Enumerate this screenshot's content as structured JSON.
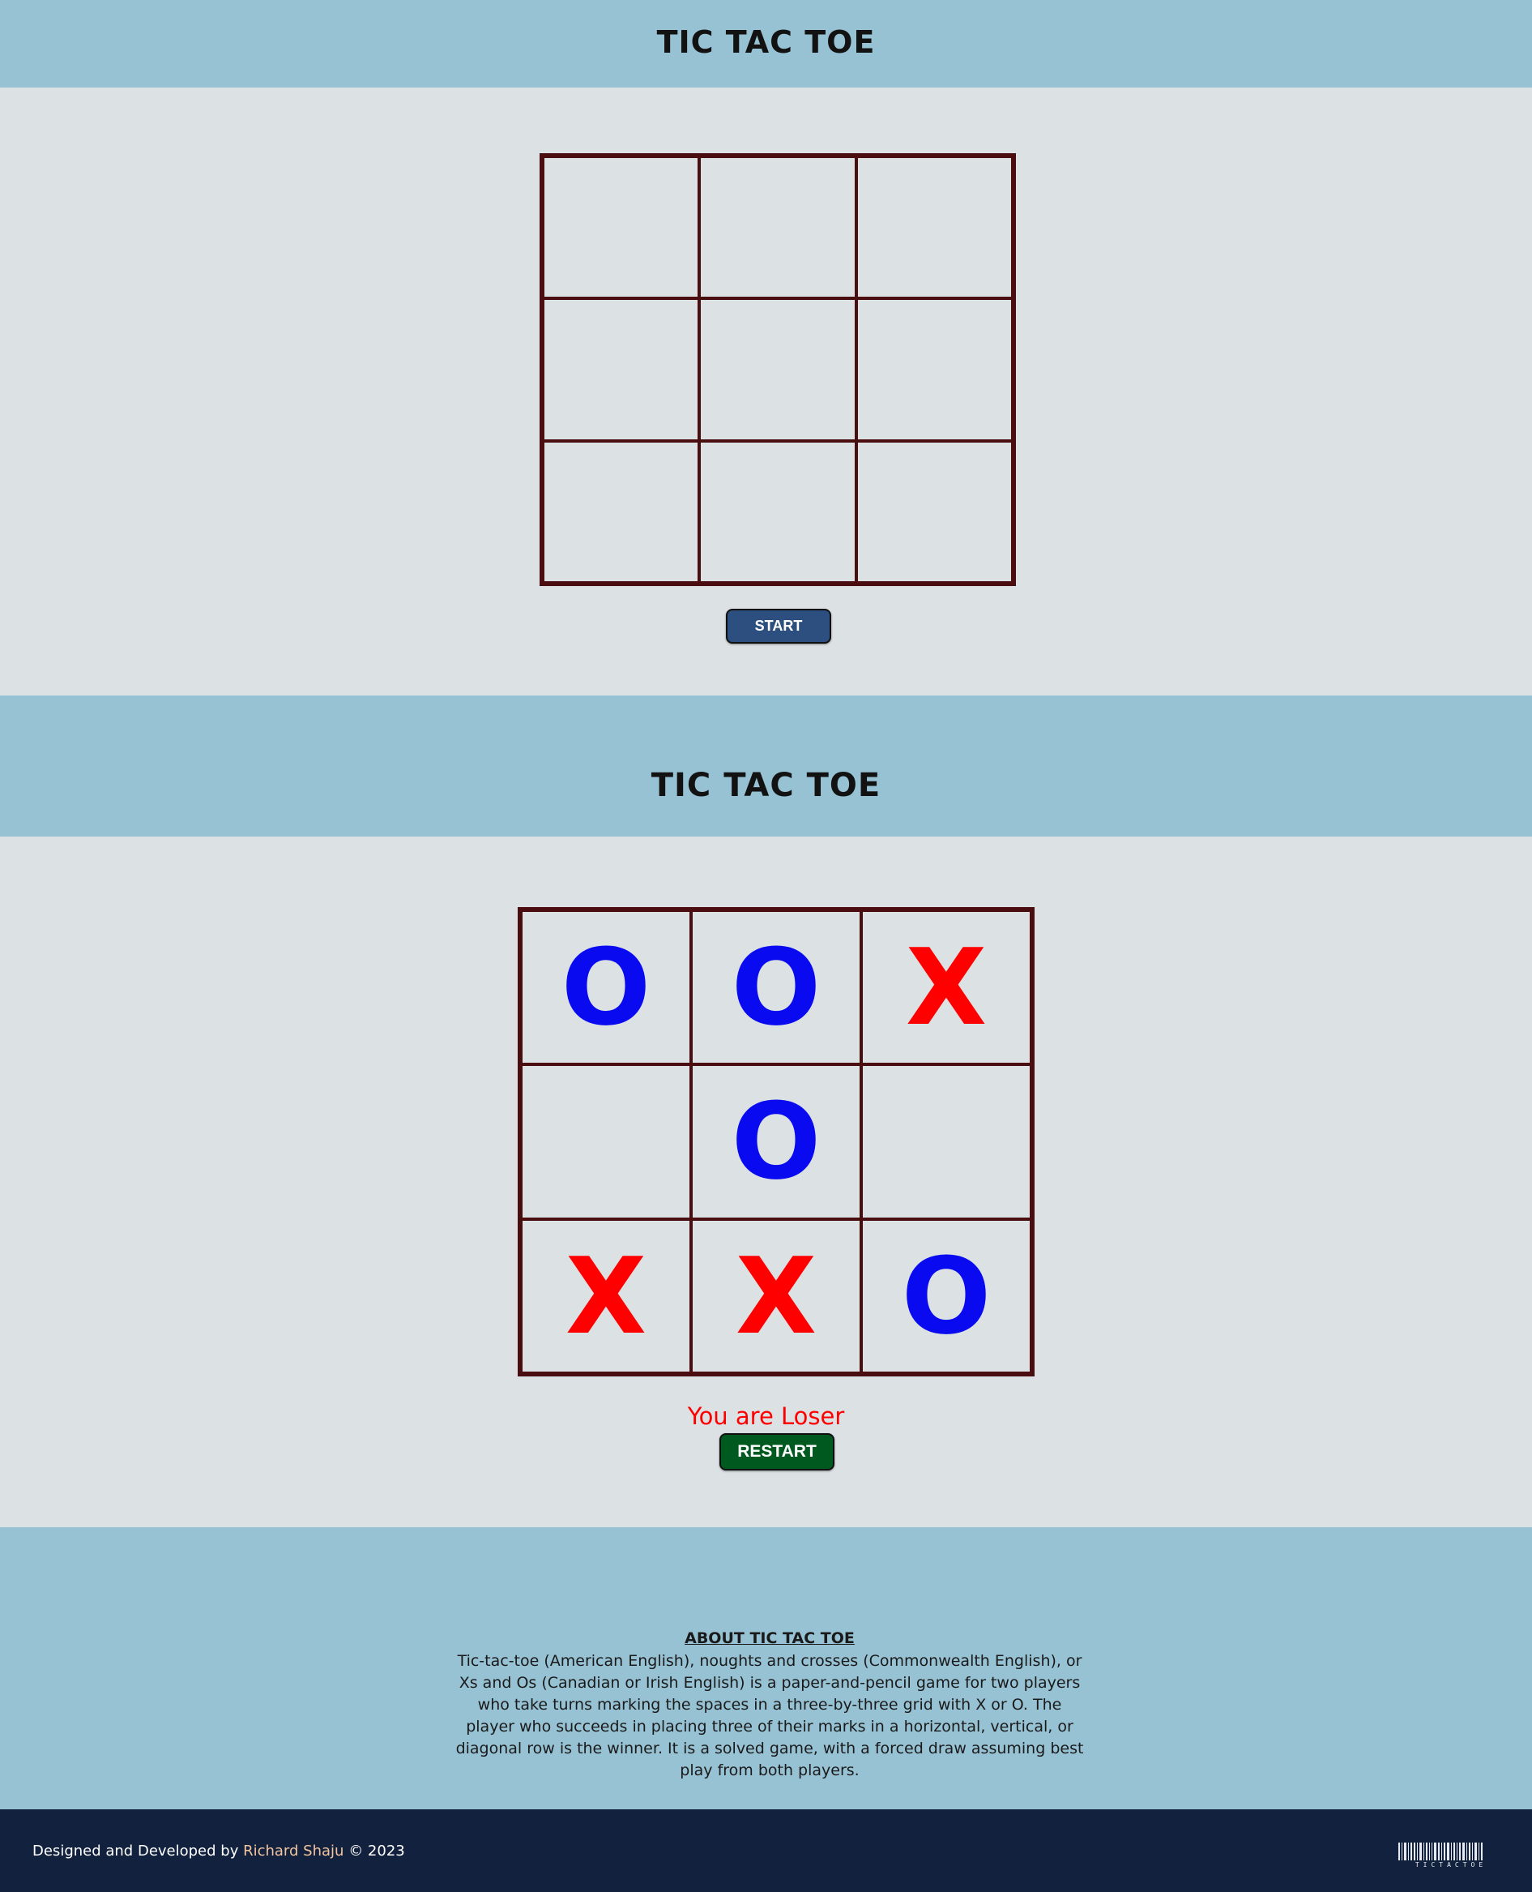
{
  "colors": {
    "header_band": "#97c2d4",
    "page_bg": "#dce1e4",
    "grid_line": "#4a0e10",
    "x_mark": "#ff0000",
    "o_mark": "#0a0af0",
    "start_button": "#2c4f80",
    "restart_button": "#005a1f",
    "result_text": "#ff0000",
    "footer_bg": "#12213d",
    "author_link": "#f2c5a0"
  },
  "game1": {
    "title": "TIC TAC TOE",
    "board": [
      "",
      "",
      "",
      "",
      "",
      "",
      "",
      "",
      ""
    ],
    "button_label": "START"
  },
  "game2": {
    "title": "TIC TAC TOE",
    "board": [
      "O",
      "O",
      "X",
      "",
      "O",
      "",
      "X",
      "X",
      "O"
    ],
    "result": "You are Loser",
    "button_label": "RESTART"
  },
  "about": {
    "heading": "ABOUT TIC TAC TOE",
    "text": "Tic-tac-toe (American English), noughts and crosses (Commonwealth English), or Xs and Os (Canadian or Irish English) is a paper-and-pencil game for two players who take turns marking the spaces in a three-by-three grid with X or O. The player who succeeds in placing three of their marks in a horizontal, vertical, or diagonal row is the winner. It is a solved game, with a forced draw assuming best play from both players."
  },
  "footer": {
    "prefix": "Designed and Developed by",
    "author": "Richard Shaju",
    "suffix": "© 2023",
    "logo_text": "TICTACTOE"
  }
}
